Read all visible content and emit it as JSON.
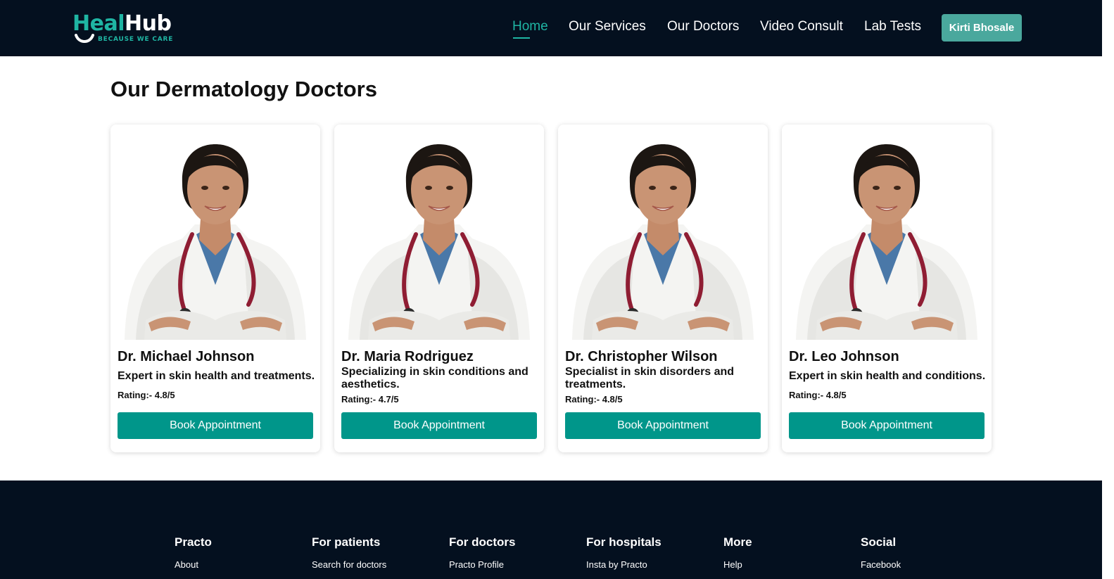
{
  "header": {
    "logo": {
      "heal": "Heal",
      "hub": "Hub",
      "tagline": "BECAUSE WE CARE"
    },
    "nav": [
      {
        "label": "Home",
        "active": true
      },
      {
        "label": "Our Services",
        "active": false
      },
      {
        "label": "Our Doctors",
        "active": false
      },
      {
        "label": "Video Consult",
        "active": false
      },
      {
        "label": "Lab Tests",
        "active": false
      }
    ],
    "user_button": "Kirti Bhosale"
  },
  "main": {
    "title": "Our Dermatology Doctors",
    "doctors": [
      {
        "name": "Dr. Michael Johnson",
        "description": "Expert in skin health and treatments.",
        "rating": "Rating:- 4.8/5",
        "button": "Book Appointment"
      },
      {
        "name": "Dr. Maria Rodriguez",
        "description": "Specializing in skin conditions and aesthetics.",
        "rating": "Rating:- 4.7/5",
        "button": "Book Appointment"
      },
      {
        "name": "Dr. Christopher Wilson",
        "description": "Specialist in skin disorders and treatments.",
        "rating": "Rating:- 4.8/5",
        "button": "Book Appointment"
      },
      {
        "name": "Dr. Leo Johnson",
        "description": "Expert in skin health and conditions.",
        "rating": "Rating:- 4.8/5",
        "button": "Book Appointment"
      }
    ]
  },
  "footer": {
    "columns": [
      {
        "heading": "Practo",
        "links": [
          "About"
        ]
      },
      {
        "heading": "For patients",
        "links": [
          "Search for doctors"
        ]
      },
      {
        "heading": "For doctors",
        "links": [
          "Practo Profile"
        ]
      },
      {
        "heading": "For hospitals",
        "links": [
          "Insta by Practo"
        ]
      },
      {
        "heading": "More",
        "links": [
          "Help"
        ]
      },
      {
        "heading": "Social",
        "links": [
          "Facebook"
        ]
      }
    ]
  },
  "colors": {
    "navy": "#04101f",
    "teal": "#00968a",
    "accent": "#1fb5a3",
    "user_button": "#4aa89d"
  }
}
